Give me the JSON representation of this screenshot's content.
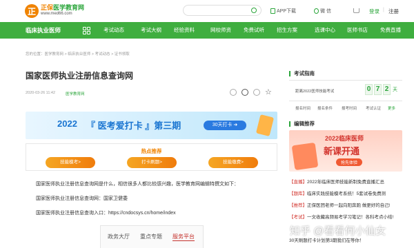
{
  "header": {
    "logo_mark": "正",
    "logo_brand": "正保",
    "logo_name": "医学教育网",
    "logo_url": "www.med66.com",
    "app_download": "APP下载",
    "wechat": "微 信",
    "login": "登录",
    "register": "注册"
  },
  "nav": {
    "home": "临床执业医师",
    "items": [
      "考试动态",
      "考试大纲",
      "经验资料",
      "网校师资",
      "免费试听",
      "招生方案",
      "选课中心",
      "医师书店",
      "免费直播"
    ]
  },
  "breadcrumb": "您的位置：医学教育网 > 临床执业医师 > 考试动态 > 证书领取",
  "article": {
    "title": "国家医师执业注册信息查询网",
    "date": "2020-03-26 11:42",
    "source": "医学教育网",
    "p1": "国家医师执业注册信息查询网是什么，相信很多人都比较感兴趣，医学教育网编辑特撰文如下：",
    "p2": "国家医师执业注册信息查询网：国家卫健委",
    "p3": "国家医师执业注册信息查询入口：https://cndocsys.cn/home/index"
  },
  "banner": {
    "year": "2022",
    "main": "『 医考爱打卡 』第三期",
    "button": "30天打卡 ➜"
  },
  "hot": {
    "title": "热点推荐",
    "buttons": [
      "技能模考>",
      "打卡刷题>",
      "技能缴费>"
    ]
  },
  "image_tabs": [
    "政务大厅",
    "重点专题",
    "服务平台"
  ],
  "sidebar": {
    "exam_guide_title": "考试指南",
    "countdown_label": "距离2022医师技能考试",
    "countdown_digits": [
      "0",
      "7",
      "2"
    ],
    "countdown_unit": "天",
    "links": [
      "报名时间",
      "报名条件",
      "报考时间",
      "考试认证",
      "更多"
    ],
    "recommend_title": "编辑推荐",
    "promo_top": "2022临床医师",
    "promo_main": "新课开通",
    "promo_btn": "抢先体验",
    "news": [
      {
        "tag": "【直播】",
        "text": "2022年临床医师技能新制免费直播汇总"
      },
      {
        "tag": "【题库】",
        "text": "临床实践技能模考系统！5套试卷免费测"
      },
      {
        "tag": "【推荐】",
        "text": "正保医团老师一起向阳奔跑 做更好的自己!"
      },
      {
        "tag": "【考试】",
        "text": "一文收藏高频易考学习笔记！各科考点小结!"
      },
      {
        "tag": "",
        "text": "30天刷题打卡计划第3期我们在等你！"
      }
    ]
  },
  "watermark": "知乎 @看看何小仙女"
}
